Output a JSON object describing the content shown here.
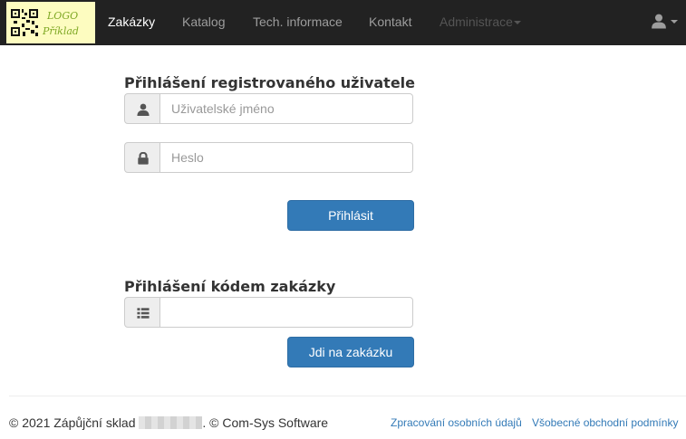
{
  "navbar": {
    "logo": {
      "line1": "LOGO",
      "line2": "Příklad"
    },
    "items": [
      {
        "label": "Zakázky",
        "state": "active"
      },
      {
        "label": "Katalog",
        "state": "normal"
      },
      {
        "label": "Tech. informace",
        "state": "normal"
      },
      {
        "label": "Kontakt",
        "state": "normal"
      },
      {
        "label": "Administrace",
        "state": "disabled",
        "has_caret": true
      }
    ],
    "user_icon": "user-icon"
  },
  "login": {
    "title": "Přihlášení registrovaného uživatele",
    "username_placeholder": "Uživatelské jméno",
    "username_value": "",
    "username_icon": "user-icon",
    "password_placeholder": "Heslo",
    "password_value": "",
    "password_icon": "lock-icon",
    "submit_label": "Přihlásit"
  },
  "order_code": {
    "title": "Přihlášení kódem zakázky",
    "code_value": "",
    "code_icon": "list-icon",
    "submit_label": "Jdi na zakázku"
  },
  "footer": {
    "copyright_prefix": "© 2021 Zápůjční sklad",
    "copyright_suffix": ". © Com-Sys Software",
    "links": [
      {
        "label": "Zpracování osobních údajů"
      },
      {
        "label": "Všobecné obchodní podmínky"
      }
    ]
  },
  "colors": {
    "navbar_bg": "#222222",
    "accent": "#337ab7",
    "logo_bg": "#fdfcc0"
  }
}
